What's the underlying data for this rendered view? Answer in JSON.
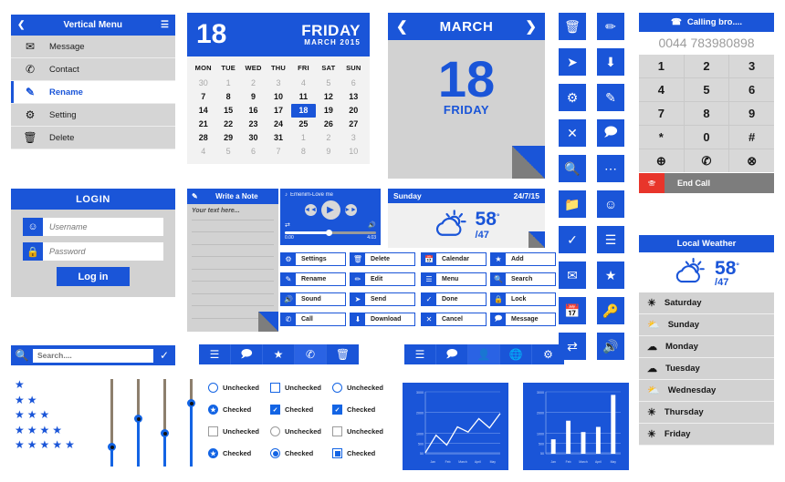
{
  "vertical_menu": {
    "title": "Vertical Menu",
    "back_icon": "chevron-left-icon",
    "hamburger_icon": "hamburger-icon",
    "items": [
      {
        "label": "Message",
        "icon": "mail-icon",
        "active": false
      },
      {
        "label": "Contact",
        "icon": "phone-icon",
        "active": false
      },
      {
        "label": "Rename",
        "icon": "edit-icon",
        "active": true
      },
      {
        "label": "Setting",
        "icon": "gear-icon",
        "active": false
      },
      {
        "label": "Delete",
        "icon": "trash-icon",
        "active": false
      }
    ]
  },
  "calendar": {
    "day_number": "18",
    "day_of_week": "FRIDAY",
    "month_year": "MARCH 2015",
    "weekday_headers": [
      "MON",
      "TUE",
      "WED",
      "THU",
      "FRI",
      "SAT",
      "SUN"
    ],
    "weeks": [
      [
        {
          "d": "30",
          "m": true
        },
        {
          "d": "1",
          "m": true
        },
        {
          "d": "2",
          "m": true
        },
        {
          "d": "3",
          "m": true
        },
        {
          "d": "4",
          "m": true
        },
        {
          "d": "5",
          "m": true
        },
        {
          "d": "6",
          "m": true
        }
      ],
      [
        {
          "d": "7"
        },
        {
          "d": "8"
        },
        {
          "d": "9"
        },
        {
          "d": "10"
        },
        {
          "d": "11"
        },
        {
          "d": "12"
        },
        {
          "d": "13"
        }
      ],
      [
        {
          "d": "14"
        },
        {
          "d": "15"
        },
        {
          "d": "16"
        },
        {
          "d": "17"
        },
        {
          "d": "18",
          "s": true
        },
        {
          "d": "19"
        },
        {
          "d": "20"
        }
      ],
      [
        {
          "d": "21"
        },
        {
          "d": "22"
        },
        {
          "d": "23"
        },
        {
          "d": "24"
        },
        {
          "d": "25"
        },
        {
          "d": "26"
        },
        {
          "d": "27"
        }
      ],
      [
        {
          "d": "28"
        },
        {
          "d": "29"
        },
        {
          "d": "30"
        },
        {
          "d": "31"
        },
        {
          "d": "1",
          "m": true
        },
        {
          "d": "2",
          "m": true
        },
        {
          "d": "3",
          "m": true
        }
      ],
      [
        {
          "d": "4",
          "m": true
        },
        {
          "d": "5",
          "m": true
        },
        {
          "d": "6",
          "m": true
        },
        {
          "d": "7",
          "m": true
        },
        {
          "d": "8",
          "m": true
        },
        {
          "d": "9",
          "m": true
        },
        {
          "d": "10",
          "m": true
        }
      ]
    ]
  },
  "month_card": {
    "prev_icon": "chevron-left-icon",
    "next_icon": "chevron-right-icon",
    "month": "MARCH",
    "day_number": "18",
    "day_name": "FRIDAY"
  },
  "icon_grid": {
    "icons": [
      "trash-icon",
      "pencil-icon",
      "send-icon",
      "download-icon",
      "gear-icon",
      "edit-icon",
      "close-icon",
      "chat-icon",
      "search-icon",
      "more-icon",
      "folder-icon",
      "smiley-icon",
      "check-icon",
      "menu-icon",
      "mail-icon",
      "star-icon",
      "calendar-icon",
      "key-icon",
      "shuffle-icon",
      "volume-icon"
    ]
  },
  "dialpad": {
    "header_label": "Calling bro....",
    "header_icon": "calling-icon",
    "number": "0044 783980898",
    "keys": [
      "1",
      "2",
      "3",
      "4",
      "5",
      "6",
      "7",
      "8",
      "9",
      "*",
      "0",
      "#"
    ],
    "bottom_keys": [
      "add-contact-icon",
      "call-icon",
      "delete-icon"
    ],
    "end_call_label": "End Call",
    "end_call_icon": "hangup-icon",
    "end_call_color": "#e8352b"
  },
  "local_weather": {
    "title": "Local Weather",
    "temp_high": "58",
    "degree": "°",
    "temp_low": "/47",
    "main_icon": "partly-sunny-icon",
    "days": [
      {
        "label": "Saturday",
        "icon": "sun-icon"
      },
      {
        "label": "Sunday",
        "icon": "partly-sunny-icon"
      },
      {
        "label": "Monday",
        "icon": "rain-icon"
      },
      {
        "label": "Tuesday",
        "icon": "rain-icon"
      },
      {
        "label": "Wednesday",
        "icon": "partly-sunny-icon"
      },
      {
        "label": "Thursday",
        "icon": "sun-icon"
      },
      {
        "label": "Friday",
        "icon": "sun-icon"
      }
    ]
  },
  "login": {
    "title": "LOGIN",
    "username_placeholder": "Username",
    "username_value": "",
    "username_icon": "smiley-icon",
    "password_placeholder": "Password",
    "password_value": "",
    "password_icon": "lock-icon",
    "button_label": "Log in"
  },
  "note": {
    "title": "Write a Note",
    "icon": "edit-icon",
    "placeholder": "Your text here..."
  },
  "player": {
    "track": "Emenim-Love me",
    "track_icon": "music-note-icon",
    "prev_icon": "rewind-icon",
    "play_icon": "play-icon",
    "next_icon": "forward-icon",
    "shuffle_icon": "shuffle-icon",
    "volume_icon": "volume-icon",
    "menu_icon": "more-vertical-icon",
    "time_current": "0.00",
    "time_total": "4.03"
  },
  "weather_card": {
    "day": "Sunday",
    "date": "24/7/15",
    "temp_high": "58",
    "degree": "°",
    "temp_low": "/47",
    "icon": "partly-sunny-icon"
  },
  "button_columns": [
    [
      {
        "label": "Settings",
        "icon": "gear-icon"
      },
      {
        "label": "Rename",
        "icon": "edit-icon"
      },
      {
        "label": "Sound",
        "icon": "volume-icon"
      },
      {
        "label": "Call",
        "icon": "phone-icon"
      }
    ],
    [
      {
        "label": "Delete",
        "icon": "trash-icon"
      },
      {
        "label": "Edit",
        "icon": "pencil-icon"
      },
      {
        "label": "Send",
        "icon": "send-icon"
      },
      {
        "label": "Download",
        "icon": "download-icon"
      }
    ],
    [
      {
        "label": "Calendar",
        "icon": "calendar-icon"
      },
      {
        "label": "Menu",
        "icon": "menu-icon"
      },
      {
        "label": "Done",
        "icon": "check-icon"
      },
      {
        "label": "Cancel",
        "icon": "close-icon"
      }
    ],
    [
      {
        "label": "Add",
        "icon": "star-icon"
      },
      {
        "label": "Search",
        "icon": "search-icon"
      },
      {
        "label": "Lock",
        "icon": "lock-icon"
      },
      {
        "label": "Message",
        "icon": "chat-icon"
      }
    ]
  ],
  "toolbars": [
    {
      "items": [
        "menu-icon",
        "chat-icon",
        "star-icon",
        "phone-icon",
        "trash-icon"
      ],
      "active_index": 3
    },
    {
      "items": [
        "menu-icon",
        "chat-icon",
        "person-icon",
        "globe-icon",
        "gear-icon"
      ],
      "active_index": 2
    }
  ],
  "search": {
    "placeholder": "Search....",
    "value": "",
    "search_icon": "search-icon",
    "submit_icon": "check-icon"
  },
  "stars": {
    "icon": "star-icon",
    "rows": [
      1,
      2,
      3,
      4,
      5
    ]
  },
  "sliders": {
    "values": [
      22,
      55,
      38,
      72
    ]
  },
  "checks": [
    {
      "label": "Unchecked",
      "style": "rd-b",
      "state": "empty"
    },
    {
      "label": "Unchecked",
      "style": "sq-b",
      "state": "empty"
    },
    {
      "label": "Unchecked",
      "style": "rd-b",
      "state": "empty"
    },
    {
      "label": "Checked",
      "style": "rd-b",
      "state": "star"
    },
    {
      "label": "Checked",
      "style": "sq-b",
      "state": "tick"
    },
    {
      "label": "Checked",
      "style": "sq-b",
      "state": "tick"
    },
    {
      "label": "Unchecked",
      "style": "sq-g",
      "state": "empty"
    },
    {
      "label": "Unchecked",
      "style": "rd-g",
      "state": "empty"
    },
    {
      "label": "Unchecked",
      "style": "sq-g",
      "state": "empty"
    },
    {
      "label": "Checked",
      "style": "rd-b",
      "state": "star"
    },
    {
      "label": "Checked",
      "style": "rd-b",
      "state": "dot"
    },
    {
      "label": "Checked",
      "style": "sq-b",
      "state": "sqin"
    }
  ],
  "chart_data": [
    {
      "type": "line",
      "title": "",
      "categories": [
        "Jan",
        "Feb",
        "March",
        "April",
        "May"
      ],
      "x": [
        "Jan",
        "Feb",
        "March",
        "April",
        "May"
      ],
      "values": [
        50,
        900,
        420,
        1300,
        1050,
        1700,
        1250,
        1950
      ],
      "yticks": [
        50,
        500,
        1000,
        2000,
        3000
      ],
      "ylim": [
        0,
        3000
      ],
      "xlabel": "",
      "ylabel": "",
      "grid": true,
      "legend": "none",
      "line_color": "#ffffff",
      "bg_color": "#1a55d8"
    },
    {
      "type": "bar",
      "title": "",
      "categories": [
        "Jan",
        "Feb",
        "March",
        "April",
        "May"
      ],
      "values": [
        700,
        1600,
        1050,
        1300,
        2850
      ],
      "yticks": [
        50,
        500,
        1000,
        2000,
        3000
      ],
      "ylim": [
        0,
        3000
      ],
      "xlabel": "",
      "ylabel": "",
      "grid": true,
      "legend": "none",
      "bar_color": "#ffffff",
      "bg_color": "#1a55d8"
    }
  ]
}
